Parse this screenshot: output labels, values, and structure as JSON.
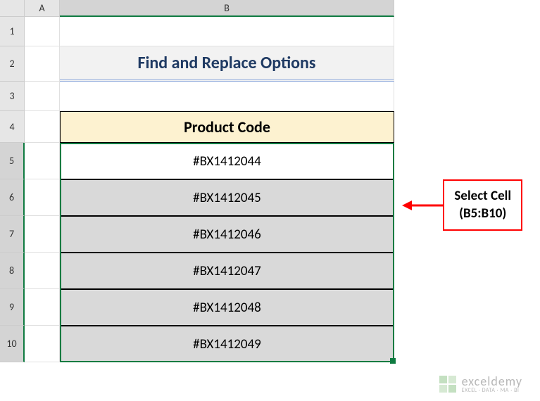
{
  "columns": {
    "A": "A",
    "B": "B"
  },
  "rows": {
    "r1": "1",
    "r2": "2",
    "r3": "3",
    "r4": "4",
    "r5": "5",
    "r6": "6",
    "r7": "7",
    "r8": "8",
    "r9": "9",
    "r10": "10"
  },
  "title": "Find and Replace Options",
  "table_header": "Product Code",
  "data": {
    "0": "#BX1412044",
    "1": "#BX1412045",
    "2": "#BX1412046",
    "3": "#BX1412047",
    "4": "#BX1412048",
    "5": "#BX1412049"
  },
  "callout": {
    "line1": "Select Cell",
    "line2": "(B5:B10)"
  },
  "watermark": {
    "brand": "exceldemy",
    "tag": "EXCEL · DATA · MA · BI"
  },
  "chart_data": {
    "type": "table",
    "title": "Find and Replace Options",
    "columns": [
      "Product Code"
    ],
    "rows": [
      [
        "#BX1412044"
      ],
      [
        "#BX1412045"
      ],
      [
        "#BX1412046"
      ],
      [
        "#BX1412047"
      ],
      [
        "#BX1412048"
      ],
      [
        "#BX1412049"
      ]
    ],
    "selection": "B5:B10"
  }
}
